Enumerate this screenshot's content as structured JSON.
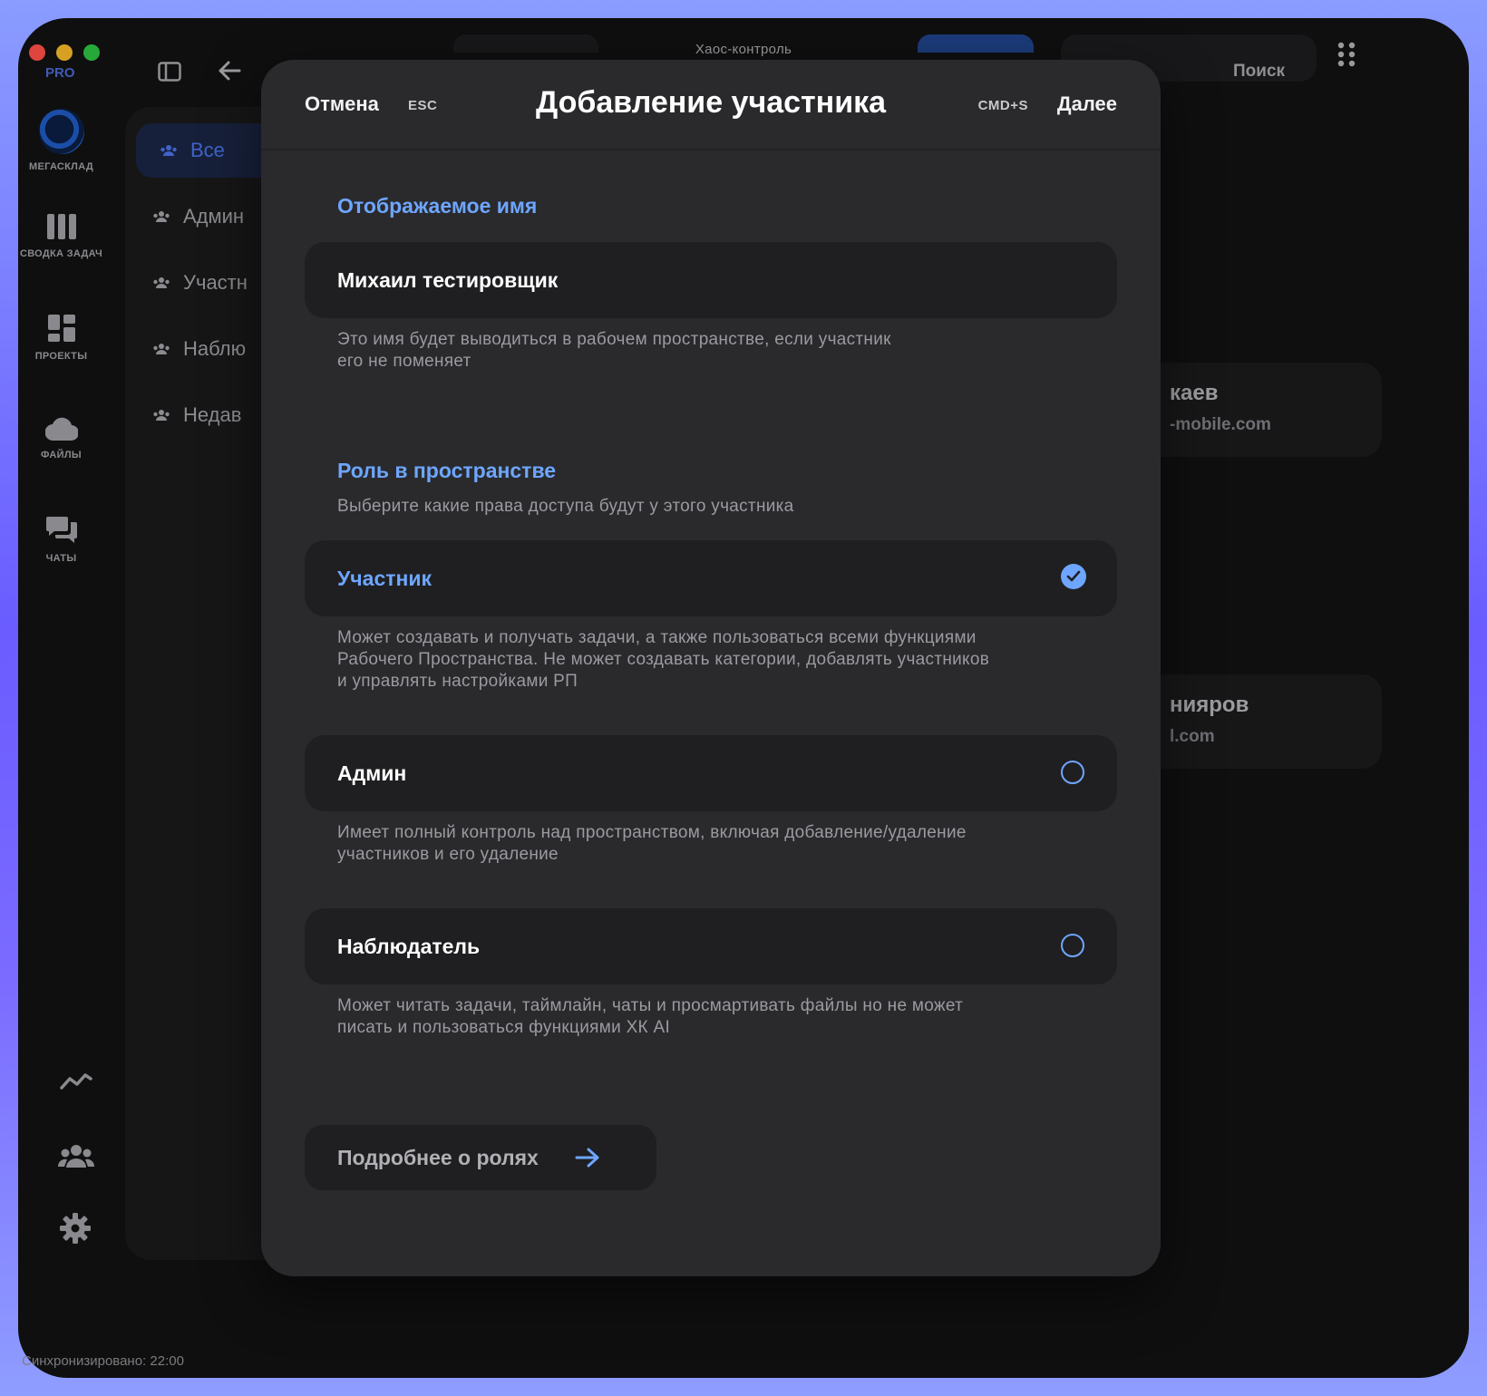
{
  "window": {
    "title": "Хаос-контроль"
  },
  "rail": {
    "badge": "PRO",
    "items": [
      {
        "label": "МЕГАСКЛАД",
        "icon": "workspace-logo-icon"
      },
      {
        "label": "СВОДКА ЗАДАЧ",
        "icon": "columns-icon"
      },
      {
        "label": "ПРОЕКТЫ",
        "icon": "dashboard-icon"
      },
      {
        "label": "ФАЙЛЫ",
        "icon": "cloud-icon"
      },
      {
        "label": "ЧАТЫ",
        "icon": "chat-icon"
      }
    ],
    "bottom_icons": [
      "analytics-icon",
      "team-icon",
      "settings-icon"
    ],
    "sync_status": "Синхронизировано: 22:00"
  },
  "sidebar": {
    "items": [
      {
        "label": "Все",
        "active": true
      },
      {
        "label": "Админ"
      },
      {
        "label": "Участн"
      },
      {
        "label": "Наблю"
      },
      {
        "label": "Недав"
      }
    ]
  },
  "toolbar": {
    "search_label": "Поиск"
  },
  "background_cards": [
    {
      "name": "каев",
      "email": "-mobile.com"
    },
    {
      "name": "нияров",
      "email": "l.com"
    }
  ],
  "modal": {
    "cancel_label": "Отмена",
    "cancel_shortcut": "ESC",
    "title": "Добавление участника",
    "next_shortcut": "CMD+S",
    "next_label": "Далее",
    "display_name": {
      "section_title": "Отображаемое имя",
      "value": "Михаил тестировщик",
      "hint_line1": "Это имя будет выводиться в рабочем пространстве, если участник",
      "hint_line2": "его не поменяет"
    },
    "role": {
      "section_title": "Роль в пространстве",
      "subtitle": "Выберите какие права доступа будут у этого участника",
      "options": [
        {
          "label": "Участник",
          "selected": true,
          "desc_lines": [
            "Может создавать и получать задачи, а также пользоваться всеми функциями",
            "Рабочего Пространства. Не может создавать категории, добавлять участников",
            "и управлять настройками РП"
          ]
        },
        {
          "label": "Админ",
          "selected": false,
          "desc_lines": [
            "Имеет полный контроль над пространством, включая добавление/удаление",
            "участников и его удаление"
          ]
        },
        {
          "label": "Наблюдатель",
          "selected": false,
          "desc_lines": [
            "Может читать задачи, таймлайн, чаты и просмартивать файлы но не может",
            "писать и пользоваться функциями ХК AI"
          ]
        }
      ]
    },
    "more_roles_label": "Подробнее о ролях"
  },
  "colors": {
    "accent": "#6ea6ff",
    "modal_bg": "#2a2a2d",
    "field_bg": "#1f1f21"
  }
}
